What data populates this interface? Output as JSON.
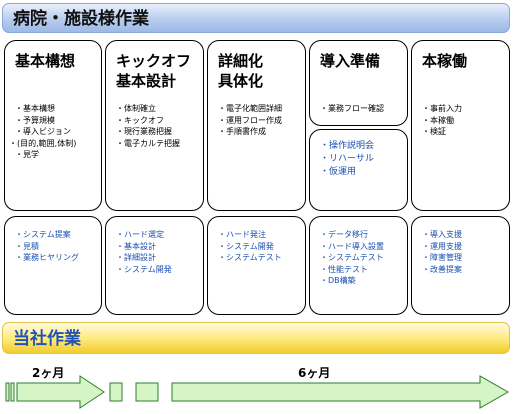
{
  "header_title": "病院・施設様作業",
  "company_title": "当社作業",
  "phases": [
    {
      "title_lines": [
        "基本構想"
      ],
      "client_tasks": [
        "基本構想",
        "予算規模",
        "導入ビジョン",
        "(目的,範囲,体制)",
        "見学"
      ],
      "extra_tasks": [],
      "company_tasks": [
        "システム提案",
        "見積",
        "業務ヒヤリング"
      ]
    },
    {
      "title_lines": [
        "キックオフ",
        "基本設計"
      ],
      "client_tasks": [
        "体制確立",
        "キックオフ",
        "現行業務把握",
        "電子カルテ把握"
      ],
      "extra_tasks": [],
      "company_tasks": [
        "ハード選定",
        "基本設計",
        "詳細設計",
        "システム開発"
      ]
    },
    {
      "title_lines": [
        "詳細化",
        "具体化"
      ],
      "client_tasks": [
        "電子化範囲詳細",
        "運用フロー作成",
        "手順書作成"
      ],
      "extra_tasks": [],
      "company_tasks": [
        "ハード発注",
        "システム開発",
        "システムテスト"
      ]
    },
    {
      "title_lines": [
        "導入準備"
      ],
      "client_tasks": [
        "業務フロー確認"
      ],
      "extra_tasks": [
        "操作説明会",
        "リハーサル",
        "仮運用"
      ],
      "company_tasks": [
        "データ移行",
        "ハード導入設置",
        "システムテスト",
        "性能テスト",
        "DB構築"
      ]
    },
    {
      "title_lines": [
        "本稼働"
      ],
      "client_tasks": [
        "事前入力",
        "本稼働",
        "検証"
      ],
      "extra_tasks": [],
      "company_tasks": [
        "導入支援",
        "運用支援",
        "障害管理",
        "改善提案"
      ]
    }
  ],
  "timeline": {
    "label_short": "2ヶ月",
    "label_long": "6ヶ月"
  },
  "colors": {
    "arrow_fill": "#d6f5c6",
    "arrow_stroke": "#2e7d2e",
    "task_blue": "#1a4fb0"
  }
}
